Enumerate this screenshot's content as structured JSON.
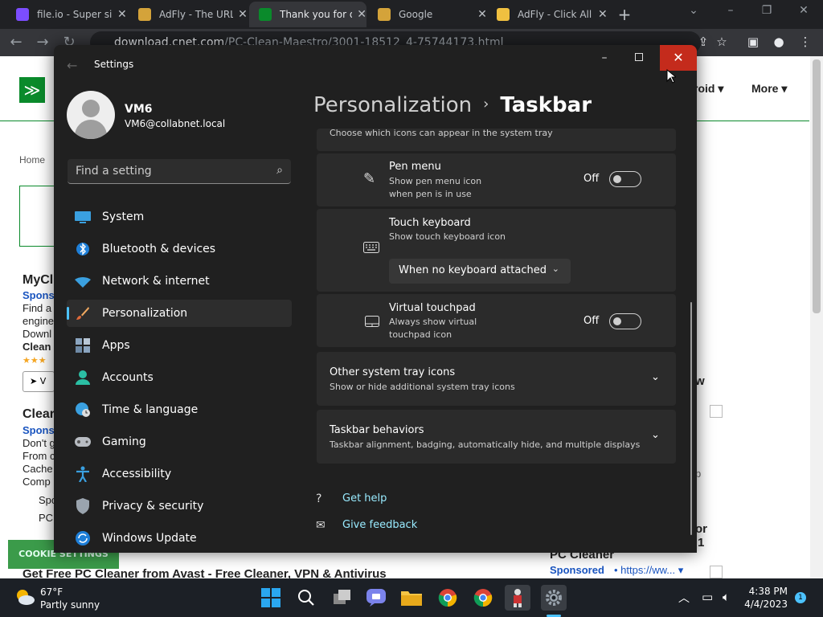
{
  "browser": {
    "tabs": [
      {
        "label": "file.io - Super si",
        "close": "✕"
      },
      {
        "label": "AdFly - The URL",
        "close": "✕"
      },
      {
        "label": "Thank you for d",
        "close": "✕"
      },
      {
        "label": "Google",
        "close": "✕"
      },
      {
        "label": "AdFly - Click All",
        "close": "✕"
      }
    ],
    "new_tab": "+",
    "url_host": "download.cnet.com",
    "url_path": "/PC-Clean-Maestro/3001-18512_4-75744173.html"
  },
  "webpage": {
    "nav_android": "roid",
    "nav_more": "More",
    "breadcrumb_home": "Home",
    "heading1": "MyCl",
    "sponsored1": "Spons",
    "snippet1": [
      "Find a",
      "engine",
      "Downl"
    ],
    "clean1": "Clean",
    "heading2": "Clear",
    "sponsored2": "Spons",
    "snippet2": [
      "Don't g",
      "From c",
      "Cache",
      "Comp"
    ],
    "sp_small": "Spo",
    "pc_small": "PC",
    "cookie_btn": "COOKIE SETTINGS",
    "bottom_title": "Get Free PC Cleaner from Avast - Free Cleaner, VPN & Antivirus",
    "pc_cleaner": "PC Cleaner",
    "sponsored_bottom": "Sponsored",
    "sponsored_url": "https://ww...",
    "right_w": "w",
    "right_p": "p",
    "right_or": "or",
    "right_1": "1"
  },
  "settings": {
    "window_title": "Settings",
    "user_name": "VM6",
    "user_email": "VM6@collabnet.local",
    "search_placeholder": "Find a setting",
    "nav": [
      {
        "label": "System"
      },
      {
        "label": "Bluetooth & devices"
      },
      {
        "label": "Network & internet"
      },
      {
        "label": "Personalization"
      },
      {
        "label": "Apps"
      },
      {
        "label": "Accounts"
      },
      {
        "label": "Time & language"
      },
      {
        "label": "Gaming"
      },
      {
        "label": "Accessibility"
      },
      {
        "label": "Privacy & security"
      },
      {
        "label": "Windows Update"
      }
    ],
    "selected": "Personalization",
    "breadcrumb_parent": "Personalization",
    "breadcrumb_sep": "›",
    "breadcrumb_current": "Taskbar",
    "tray_hint": "Choose which icons can appear in the system tray",
    "pen_menu": {
      "title": "Pen menu",
      "desc": [
        "Show pen menu icon",
        "when pen is in use"
      ],
      "state": "Off"
    },
    "touch_keyboard": {
      "title": "Touch keyboard",
      "desc": "Show touch keyboard icon",
      "dropdown": "When no keyboard attached"
    },
    "virtual_touchpad": {
      "title": "Virtual touchpad",
      "desc": [
        "Always show virtual",
        "touchpad icon"
      ],
      "state": "Off"
    },
    "other_tray": {
      "title": "Other system tray icons",
      "desc": "Show or hide additional system tray icons"
    },
    "behaviors": {
      "title": "Taskbar behaviors",
      "desc": "Taskbar alignment, badging, automatically hide, and multiple displays"
    },
    "get_help": "Get help",
    "give_feedback": "Give feedback"
  },
  "taskbar": {
    "weather_temp": "67°F",
    "weather_desc": "Partly sunny",
    "time": "4:38 PM",
    "date": "4/4/2023",
    "notification_count": "1"
  },
  "colors": {
    "accent": "#4cc2ff",
    "close_red": "#c42b1c",
    "cnet_green": "#0a8a2b",
    "link": "#99ebff"
  }
}
